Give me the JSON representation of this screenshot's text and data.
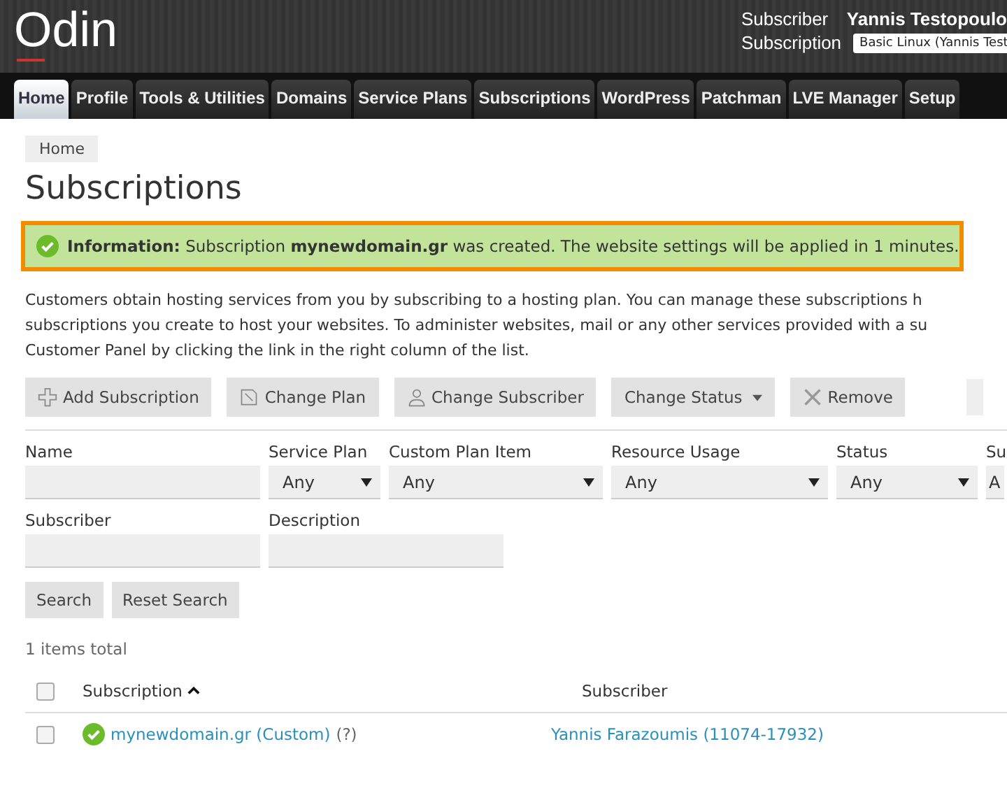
{
  "header": {
    "logo": "Odin",
    "subscriber_label": "Subscriber",
    "subscriber_name": "Yannis Testopoulo",
    "subscription_label": "Subscription",
    "subscription_value": "Basic Linux (Yannis Test"
  },
  "tabs": [
    {
      "label": "Home",
      "selected": true
    },
    {
      "label": "Profile",
      "selected": false
    },
    {
      "label": "Tools & Utilities",
      "selected": false
    },
    {
      "label": "Domains",
      "selected": false
    },
    {
      "label": "Service Plans",
      "selected": false
    },
    {
      "label": "Subscriptions",
      "selected": false
    },
    {
      "label": "WordPress",
      "selected": false
    },
    {
      "label": "Patchman",
      "selected": false
    },
    {
      "label": "LVE Manager",
      "selected": false
    },
    {
      "label": "Setup",
      "selected": false
    }
  ],
  "breadcrumb": "Home",
  "title": "Subscriptions",
  "message": "**Information:** Subscription **mynewdomain.gr** was created. The website settings will be applied in 1 minutes.",
  "description": [
    "Customers obtain hosting services from you by subscribing to a hosting plan. You can manage these subscriptions h",
    "subscriptions you create to host your websites. To administer websites, mail or any other services provided with a su",
    "Customer Panel by clicking the link in the right column of the list."
  ],
  "toolbar": [
    "Add Subscription",
    "Change Plan",
    "Change Subscriber",
    "Change Status",
    "Remove"
  ],
  "filters": [
    [
      {
        "label": "Name",
        "kind": "text"
      },
      {
        "label": "Service Plan",
        "kind": "select",
        "value": "Any"
      },
      {
        "label": "Custom Plan Item",
        "kind": "select",
        "value": "Any"
      },
      {
        "label": "Resource Usage",
        "kind": "select",
        "value": "Any"
      },
      {
        "label": "Status",
        "kind": "select",
        "value": "Any"
      },
      {
        "label": "Su",
        "kind": "select",
        "value": "A"
      }
    ],
    [
      {
        "label": "Subscriber",
        "kind": "text"
      },
      {
        "label": "Description",
        "kind": "text"
      }
    ]
  ],
  "search_buttons": [
    "Search",
    "Reset Search"
  ],
  "total": "1 items total",
  "table": {
    "select_all_checked": false,
    "columns": [
      {
        "label": "Subscription",
        "sorted": true
      },
      {
        "label": "Subscriber",
        "sorted": false
      }
    ],
    "rows": [
      {
        "checked": false,
        "subscription": "mynewdomain.gr (Custom)",
        "help": "(?)",
        "subscriber": "Yannis Farazoumis (11074-17932)"
      }
    ]
  }
}
